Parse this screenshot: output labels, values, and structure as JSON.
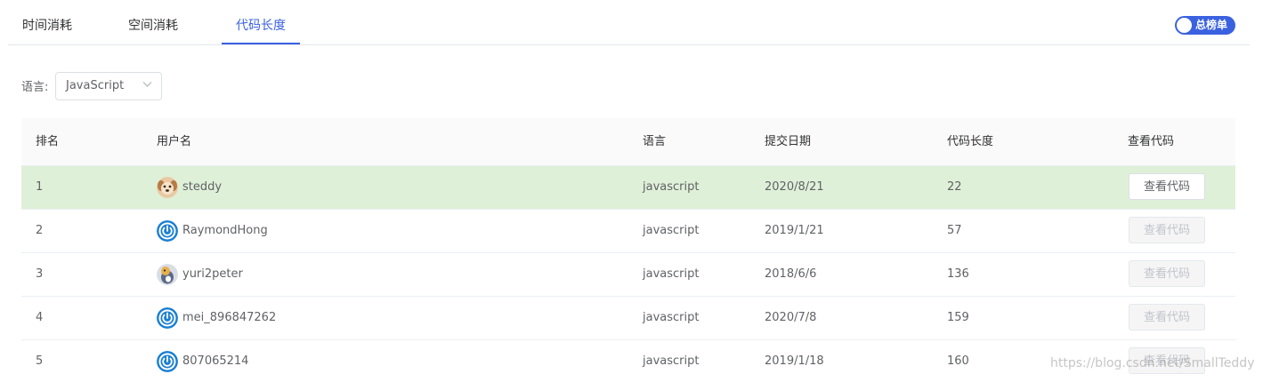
{
  "tabs": [
    {
      "label": "时间消耗",
      "active": false
    },
    {
      "label": "空间消耗",
      "active": false
    },
    {
      "label": "代码长度",
      "active": true
    }
  ],
  "toggle": {
    "label": "总榜单",
    "on": true
  },
  "filter": {
    "label": "语言:",
    "selected": "JavaScript",
    "arrow_icon": "chevron-down-icon"
  },
  "table": {
    "headers": [
      "排名",
      "用户名",
      "语言",
      "提交日期",
      "代码长度",
      "查看代码"
    ],
    "rows": [
      {
        "rank": "1",
        "user": "steddy",
        "avatar": "dog-avatar",
        "lang": "javascript",
        "date": "2020/8/21",
        "length": "22",
        "button": "查看代码",
        "enabled": true,
        "highlight": true
      },
      {
        "rank": "2",
        "user": "RaymondHong",
        "avatar": "power-avatar",
        "lang": "javascript",
        "date": "2019/1/21",
        "length": "57",
        "button": "查看代码",
        "enabled": false,
        "highlight": false
      },
      {
        "rank": "3",
        "user": "yuri2peter",
        "avatar": "bird-avatar",
        "lang": "javascript",
        "date": "2018/6/6",
        "length": "136",
        "button": "查看代码",
        "enabled": false,
        "highlight": false
      },
      {
        "rank": "4",
        "user": "mei_896847262",
        "avatar": "power-avatar",
        "lang": "javascript",
        "date": "2020/7/8",
        "length": "159",
        "button": "查看代码",
        "enabled": false,
        "highlight": false
      },
      {
        "rank": "5",
        "user": "807065214",
        "avatar": "power-avatar",
        "lang": "javascript",
        "date": "2019/1/18",
        "length": "160",
        "button": "查看代码",
        "enabled": false,
        "highlight": false
      }
    ]
  },
  "colors": {
    "accent": "#3a61e0",
    "highlight_row": "#dff0d8",
    "power_avatar": "#1a7fd1"
  },
  "watermark": "https://blog.csdn.net/SmallTeddy"
}
